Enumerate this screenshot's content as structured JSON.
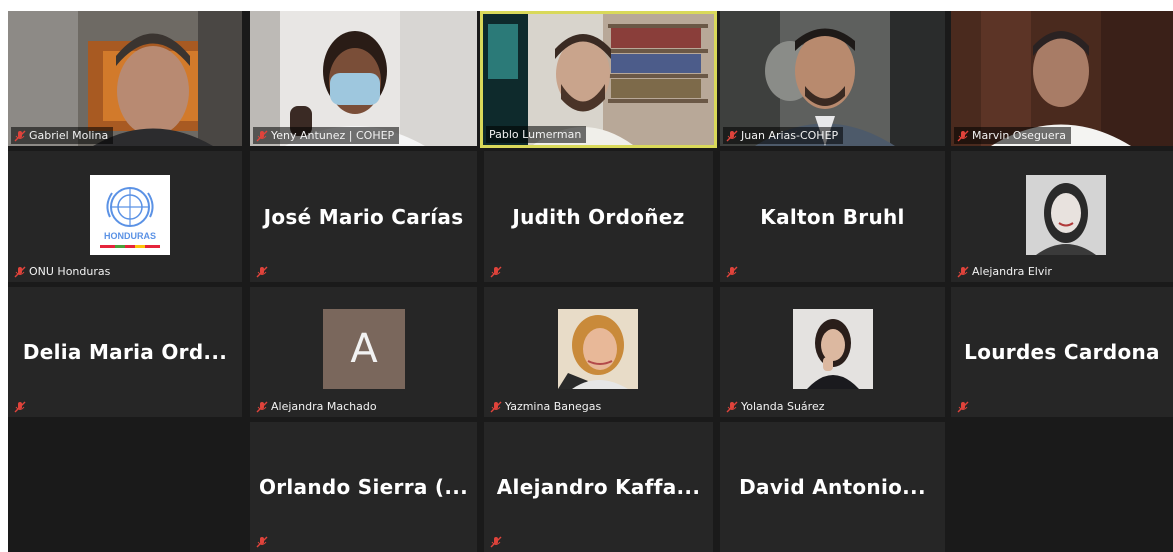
{
  "participants": [
    {
      "name": "Gabriel Molina",
      "muted": true
    },
    {
      "name": "Yeny Antunez | COHEP",
      "muted": true
    },
    {
      "name": "Pablo Lumerman",
      "muted": false,
      "active_speaker": true
    },
    {
      "name": "Juan Arias-COHEP",
      "muted": true
    },
    {
      "name": "Marvin Oseguera",
      "muted": true
    },
    {
      "name": "ONU Honduras",
      "muted": true,
      "logo_text": "HONDURAS"
    },
    {
      "display_name": "José Mario Carías",
      "muted": true
    },
    {
      "display_name": "Judith Ordoñez",
      "muted": true
    },
    {
      "display_name": "Kalton Bruhl",
      "muted": true
    },
    {
      "name": "Alejandra Elvir",
      "muted": true
    },
    {
      "display_name": "Delia Maria Ord...",
      "muted": true
    },
    {
      "name": "Alejandra Machado",
      "muted": true,
      "avatar_letter": "A"
    },
    {
      "name": "Yazmina Banegas",
      "muted": true
    },
    {
      "name": "Yolanda Suárez",
      "muted": true
    },
    {
      "display_name": "Lourdes Cardona",
      "muted": true
    },
    {
      "display_name": "Orlando Sierra (...",
      "muted": true
    },
    {
      "display_name": "Alejandro Kaffa...",
      "muted": true
    },
    {
      "display_name": "David Antonio...",
      "muted": true
    }
  ],
  "icons": {
    "muted": "microphone-muted-icon"
  },
  "colors": {
    "background": "#1a1a1a",
    "tile": "#262626",
    "active_speaker_border": "#d9d95a",
    "mute_icon": "#e0433b"
  }
}
